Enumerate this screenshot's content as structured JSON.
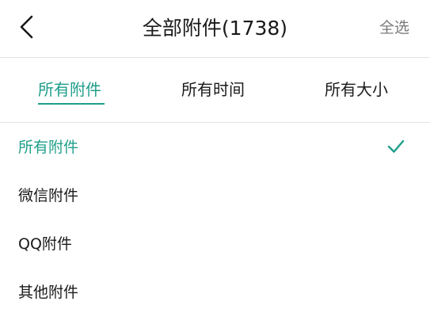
{
  "header": {
    "back_icon": "chevron-left-icon",
    "title": "全部附件(1738)",
    "select_all_label": "全选"
  },
  "tabs": [
    {
      "label": "所有附件",
      "active": true
    },
    {
      "label": "所有时间",
      "active": false
    },
    {
      "label": "所有大小",
      "active": false
    }
  ],
  "filter_options": [
    {
      "label": "所有附件",
      "selected": true
    },
    {
      "label": "微信附件",
      "selected": false
    },
    {
      "label": "QQ附件",
      "selected": false
    },
    {
      "label": "其他附件",
      "selected": false
    }
  ],
  "colors": {
    "accent": "#1f9e8b",
    "text": "#1a1a1a",
    "muted": "#7a7a7a",
    "divider": "#e2e2e2"
  },
  "icons": {
    "selected_check": "check-icon"
  }
}
